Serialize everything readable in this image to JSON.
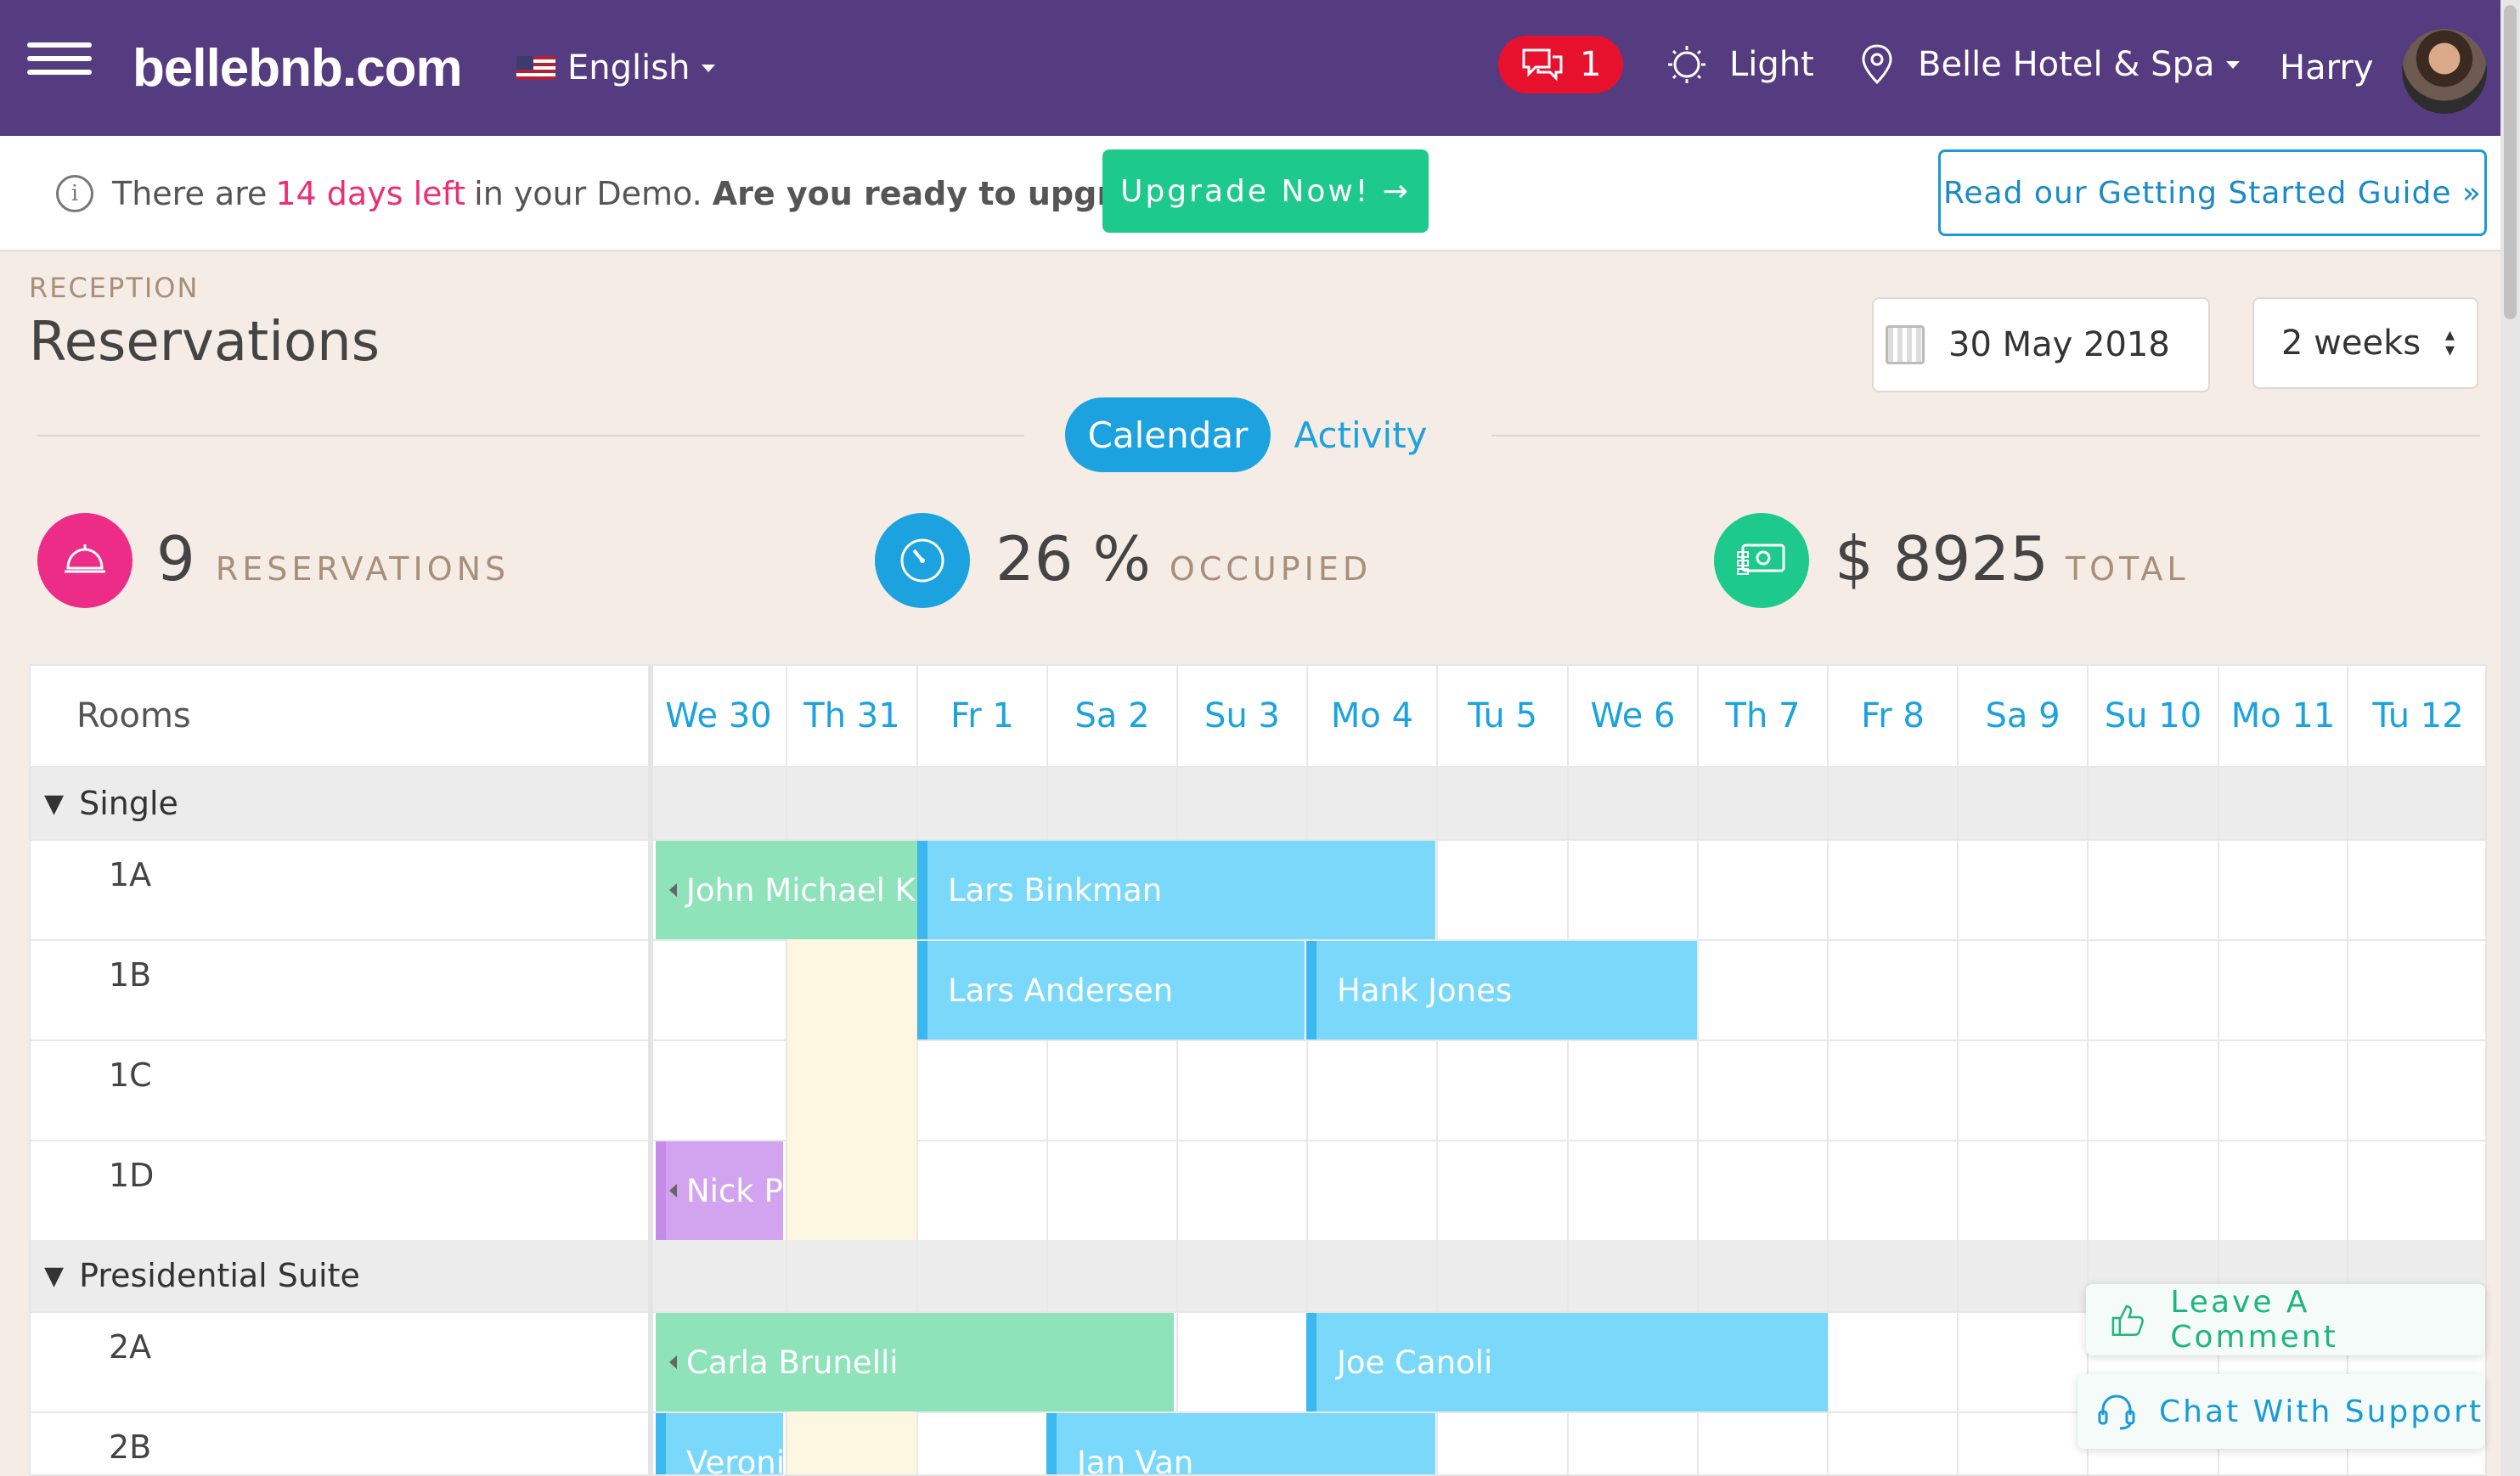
{
  "header": {
    "logo": "bellebnb.com",
    "language": "English",
    "messages_count": "1",
    "theme_label": "Light",
    "property": "Belle Hotel & Spa",
    "user_name": "Harry"
  },
  "demo_bar": {
    "text_before": "There are",
    "days_left": "14 days left",
    "text_after": "in your Demo.",
    "question": "Are you ready to upgrade?",
    "upgrade_button": "Upgrade Now! →",
    "guide_button": "Read our Getting Started Guide »"
  },
  "page": {
    "breadcrumb": "RECEPTION",
    "title": "Reservations",
    "date": "30 May 2018",
    "range": "2 weeks"
  },
  "tabs": {
    "calendar": "Calendar",
    "activity": "Activity"
  },
  "stats": {
    "reservations_value": "9",
    "reservations_label": "RESERVATIONS",
    "occupied_value": "26 %",
    "occupied_label": "OCCUPIED",
    "total_value": "$ 8925",
    "total_label": "TOTAL"
  },
  "grid": {
    "rooms_header": "Rooms",
    "days": [
      "We 30",
      "Th 31",
      "Fr 1",
      "Sa 2",
      "Su 3",
      "Mo 4",
      "Tu 5",
      "We 6",
      "Th 7",
      "Fr 8",
      "Sa 9",
      "Su 10",
      "Mo 11",
      "Tu 12"
    ],
    "groups": [
      {
        "name": "Single",
        "rooms": [
          "1A",
          "1B",
          "1C",
          "1D"
        ]
      },
      {
        "name": "Presidential Suite",
        "rooms": [
          "2A",
          "2B"
        ]
      }
    ],
    "reservations": [
      {
        "guest": "John Michael K",
        "room": "1A",
        "color": "#8ee3bb"
      },
      {
        "guest": "Lars Binkman",
        "room": "1A",
        "color": "#7ad9fa"
      },
      {
        "guest": "Lars Andersen",
        "room": "1B",
        "color": "#7ad9fa"
      },
      {
        "guest": "Hank Jones",
        "room": "1B",
        "color": "#7ad9fa"
      },
      {
        "guest": "Nick P",
        "room": "1D",
        "color": "#d2a3ef"
      },
      {
        "guest": "Carla Brunelli",
        "room": "2A",
        "color": "#8ee3bb"
      },
      {
        "guest": "Joe Canoli",
        "room": "2A",
        "color": "#7ad9fa"
      },
      {
        "guest": "Veroni",
        "room": "2B",
        "color": "#7ad9fa"
      },
      {
        "guest": "Jan Van",
        "room": "2B",
        "color": "#7ad9fa"
      }
    ]
  },
  "floating": {
    "comment": "Leave A Comment",
    "support": "Chat With Support"
  },
  "colors": {
    "topbar": "#553b80",
    "accent_blue": "#1ca2de",
    "accent_green": "#1ec98c",
    "accent_pink": "#ec2e79"
  }
}
